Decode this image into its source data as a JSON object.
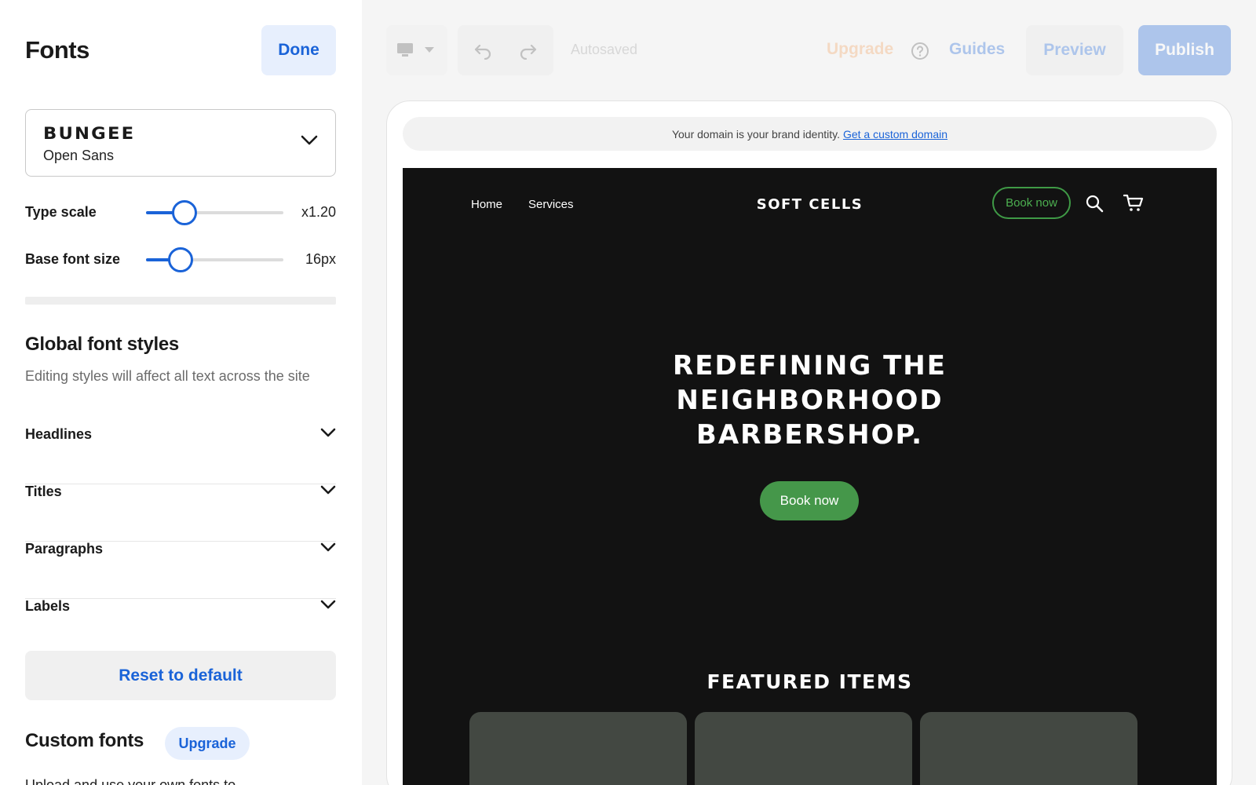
{
  "panel": {
    "title": "Fonts",
    "done_label": "Done",
    "font_pair": {
      "heading": "Bungee",
      "body": "Open Sans"
    },
    "type_scale": {
      "label": "Type scale",
      "value_text": "x1.20",
      "level": 0.28
    },
    "base_font_size": {
      "label": "Base font size",
      "value_text": "16px",
      "level": 0.25
    },
    "global_styles": {
      "title": "Global font styles",
      "subtitle": "Editing styles will affect all text across the site",
      "items": [
        {
          "label": "Headlines"
        },
        {
          "label": "Titles"
        },
        {
          "label": "Paragraphs"
        },
        {
          "label": "Labels"
        }
      ]
    },
    "reset_label": "Reset to default",
    "custom_fonts": {
      "title": "Custom fonts",
      "upgrade_label": "Upgrade",
      "desc_cut": "Upload and use your own fonts to..."
    }
  },
  "toolbar": {
    "autosaved": "Autosaved",
    "upgrade": "Upgrade",
    "guides": "Guides",
    "preview": "Preview",
    "publish": "Publish"
  },
  "preview": {
    "domain_text": "Your domain is your brand identity.",
    "domain_link": "Get a custom domain",
    "site": {
      "nav": [
        "Home",
        "Services"
      ],
      "logo": "Soft Cells",
      "book_now": "Book now",
      "hero_lines": [
        "Redefining the",
        "neighborhood",
        "barbershop."
      ],
      "hero_button": "Book now",
      "featured_title": "Featured items"
    }
  },
  "colors": {
    "accent": "#1a63d8",
    "accent_soft": "#e7effd",
    "site_bg": "#121212",
    "site_green": "#45974a",
    "card": "#434842",
    "upgrade_orange": "#f4a15c"
  }
}
